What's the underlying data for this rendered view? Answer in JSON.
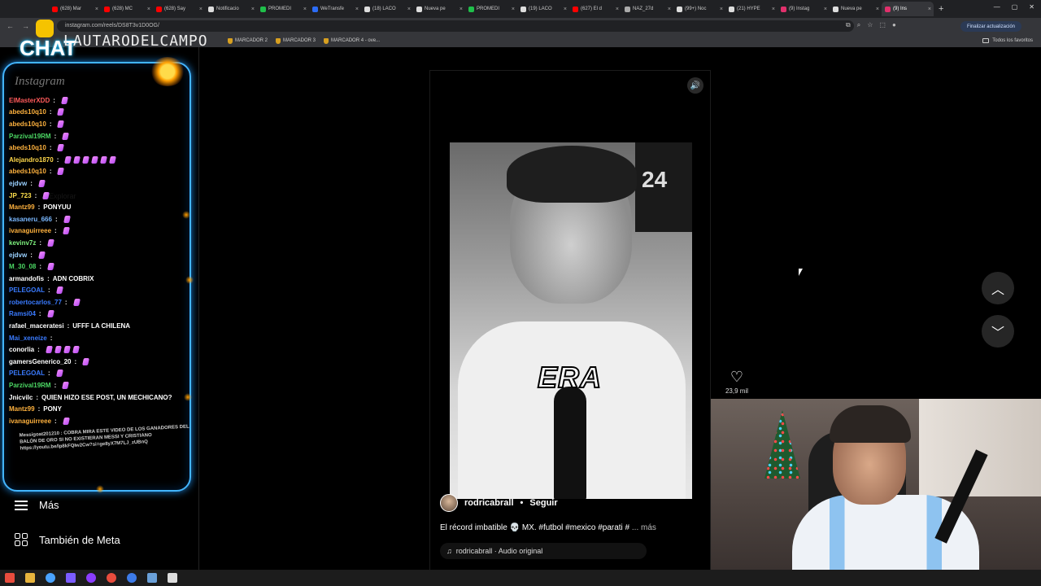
{
  "tabs": [
    {
      "label": "(628) Mar",
      "color": "#ff0000"
    },
    {
      "label": "(628) MC",
      "color": "#ff0000"
    },
    {
      "label": "(628) Say",
      "color": "#ff0000"
    },
    {
      "label": "Notificacio",
      "color": "#dddddd"
    },
    {
      "label": "PROMEDI",
      "color": "#1fbf4a"
    },
    {
      "label": "WeTransfe",
      "color": "#2c6cf6"
    },
    {
      "label": "(18) LACO",
      "color": "#dddddd"
    },
    {
      "label": "Nueva pe",
      "color": "#dddddd"
    },
    {
      "label": "PROMEDI",
      "color": "#1fbf4a"
    },
    {
      "label": "(19) LACO",
      "color": "#dddddd"
    },
    {
      "label": "(627) El d",
      "color": "#ff0000"
    },
    {
      "label": "NAZ_27d",
      "color": "#aaaaaa"
    },
    {
      "label": "(99+) Noc",
      "color": "#dddddd"
    },
    {
      "label": "(21) HYPE",
      "color": "#dddddd"
    },
    {
      "label": "(9) Instag",
      "color": "#e1306c"
    },
    {
      "label": "Nueva pe",
      "color": "#dddddd"
    },
    {
      "label": "(9) Ins",
      "color": "#e1306c",
      "active": true
    }
  ],
  "address": {
    "url": "instagram.com/reels/DS8T3v1D0OG/",
    "update_label": "Finalizar actualización"
  },
  "bookmarks": {
    "items": [
      "MARCADOR 2",
      "MARCADOR 3",
      "MARCADOR 4 - ove..."
    ],
    "all_favorites": "Todos los favoritos"
  },
  "overlay": {
    "chat_title": "CHAT",
    "streamer_name": "LAUTARODELCAMPO",
    "brand": "Instagram",
    "messages": [
      {
        "user": "ElMasterXDD",
        "text": "",
        "color": "#ff5a5a",
        "emotes": 1
      },
      {
        "user": "abeds10q10",
        "text": "",
        "color": "#ffb23e",
        "emotes": 1
      },
      {
        "user": "abeds10q10",
        "text": "",
        "color": "#ffb23e",
        "emotes": 1
      },
      {
        "user": "Parzival19RM",
        "text": "",
        "color": "#4cd964",
        "emotes": 1
      },
      {
        "user": "abeds10q10",
        "text": "",
        "color": "#ffb23e",
        "emotes": 1
      },
      {
        "user": "Alejandro1870",
        "text": "",
        "color": "#ffd84a",
        "emotes": 6
      },
      {
        "user": "abeds10q10",
        "text": "",
        "color": "#ffb23e",
        "emotes": 1
      },
      {
        "user": "ejdvw",
        "text": "",
        "color": "#9ad1ff",
        "emotes": 1
      },
      {
        "user": "JP_723",
        "text": "",
        "color": "#ffe14d",
        "emotes": 1
      },
      {
        "user": "Mantz99",
        "text": "PONYUU",
        "color": "#ffb23e",
        "emotes": 0
      },
      {
        "user": "kasaneru_666",
        "text": "",
        "color": "#7ab8ff",
        "emotes": 1
      },
      {
        "user": "ivanaguirreee",
        "text": "",
        "color": "#ffb23e",
        "emotes": 1
      },
      {
        "user": "kevinv7z",
        "text": "",
        "color": "#7ef27e",
        "emotes": 1
      },
      {
        "user": "ejdvw",
        "text": "",
        "color": "#9ad1ff",
        "emotes": 1
      },
      {
        "user": "M_30_08",
        "text": "",
        "color": "#4cd964",
        "emotes": 1
      },
      {
        "user": "armandofis",
        "text": "ADN COBRIX",
        "color": "#ffffff",
        "emotes": 0
      },
      {
        "user": "PELEGOAL",
        "text": "",
        "color": "#3a7bff",
        "emotes": 1
      },
      {
        "user": "robertocarlos_77",
        "text": "",
        "color": "#3a7bff",
        "emotes": 1
      },
      {
        "user": "Ramsi04",
        "text": "",
        "color": "#3a7bff",
        "emotes": 1
      },
      {
        "user": "rafael_maceratesi",
        "text": "UFFF LA CHILENA",
        "color": "#ffffff",
        "emotes": 0
      },
      {
        "user": "Mai_xeneize",
        "text": "",
        "color": "#3a7bff",
        "emotes": 0
      },
      {
        "user": "conorlia",
        "text": "",
        "color": "#ffffff",
        "emotes": 4
      },
      {
        "user": "gamersGenerico_20",
        "text": "",
        "color": "#ffffff",
        "emotes": 1
      },
      {
        "user": "PELEGOAL",
        "text": "",
        "color": "#3a7bff",
        "emotes": 1
      },
      {
        "user": "Parzival19RM",
        "text": "",
        "color": "#4cd964",
        "emotes": 1
      },
      {
        "user": "Jnicvilc",
        "text": "QUIEN HIZO ESE POST, UN MECHICANO?",
        "color": "#ffffff",
        "emotes": 0
      },
      {
        "user": "Mantz99",
        "text": "PONY",
        "color": "#ffb23e",
        "emotes": 0
      },
      {
        "user": "ivanaguirreee",
        "text": "",
        "color": "#ffb23e",
        "emotes": 1
      }
    ],
    "long_message": "Messigoat201210 : COBRA MIRA ESTE VIDEO DE LOS GANADORES DEL BALÓN DE ORO SI NO EXISTIERAN MESSI Y CRISTIANO https://youtu.be/lp8kFQIw2Cw?si=ge8yX7M7LJ_zUBnQ"
  },
  "ig_sidebar": {
    "more_label": "Más",
    "meta_label": "También de Meta"
  },
  "reel": {
    "overlay_text": "ERA",
    "username": "rodricabrall",
    "follow": "Seguir",
    "caption": "El récord imbatible 💀 MX. #futbol #mexico #parati #",
    "more": "... más",
    "audio": "rodricabrall · Audio original",
    "likes": "23,9 mil"
  }
}
